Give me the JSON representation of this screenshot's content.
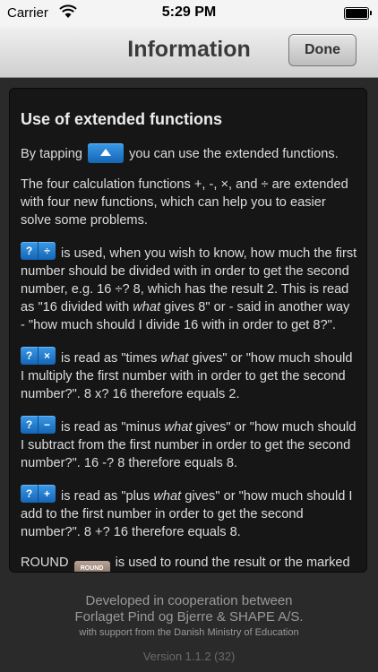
{
  "status_bar": {
    "carrier": "Carrier",
    "time": "5:29 PM"
  },
  "nav": {
    "title": "Information",
    "done_label": "Done"
  },
  "content": {
    "heading": "Use of extended functions",
    "p1_before": "By tapping",
    "p1_after": "you can use the extended functions.",
    "p2": "The four calculation functions +, -, ×, and ÷ are extended with four new functions, which can help you to easier solve some problems.",
    "div": {
      "btn_q": "?",
      "btn_op": "÷",
      "t1": " is used, when you wish to know, how much the first number should be divided with in order to get the second number, e.g. 16 ÷? 8, which has the result 2. This is read as \"16 divided with ",
      "em": "what",
      "t2": " gives 8\" or - said in another way - \"how much should I divide 16 with in order to get 8?\"."
    },
    "mul": {
      "btn_q": "?",
      "btn_op": "×",
      "t1": " is read as \"times ",
      "em": "what",
      "t2": " gives\" or \"how much should I multiply the first number with in order to get the second number?\". 8 x? 16 therefore equals 2."
    },
    "sub": {
      "btn_q": "?",
      "btn_op": "−",
      "t1": " is read as \"minus ",
      "em": "what",
      "t2": " gives\" or \"how much should I subtract from the first number in order to get the second number?\". 16 -? 8 therefore equals 8."
    },
    "add": {
      "btn_q": "?",
      "btn_op": "+",
      "t1": " is read as \"plus ",
      "em": "what",
      "t2": " gives\" or \"how much should I add to the first number in order to get the second number?\". 8 +? 16 therefore equals 8."
    },
    "round": {
      "label": "ROUND",
      "btn": "ROUND",
      "t1": " is used to round the result or the marked number."
    }
  },
  "footer": {
    "line1": "Developed in cooperation between",
    "line2": "Forlaget Pind og Bjerre & SHAPE A/S.",
    "line3": "with support from the Danish Ministry of Education",
    "version": "Version 1.1.2 (32)"
  }
}
